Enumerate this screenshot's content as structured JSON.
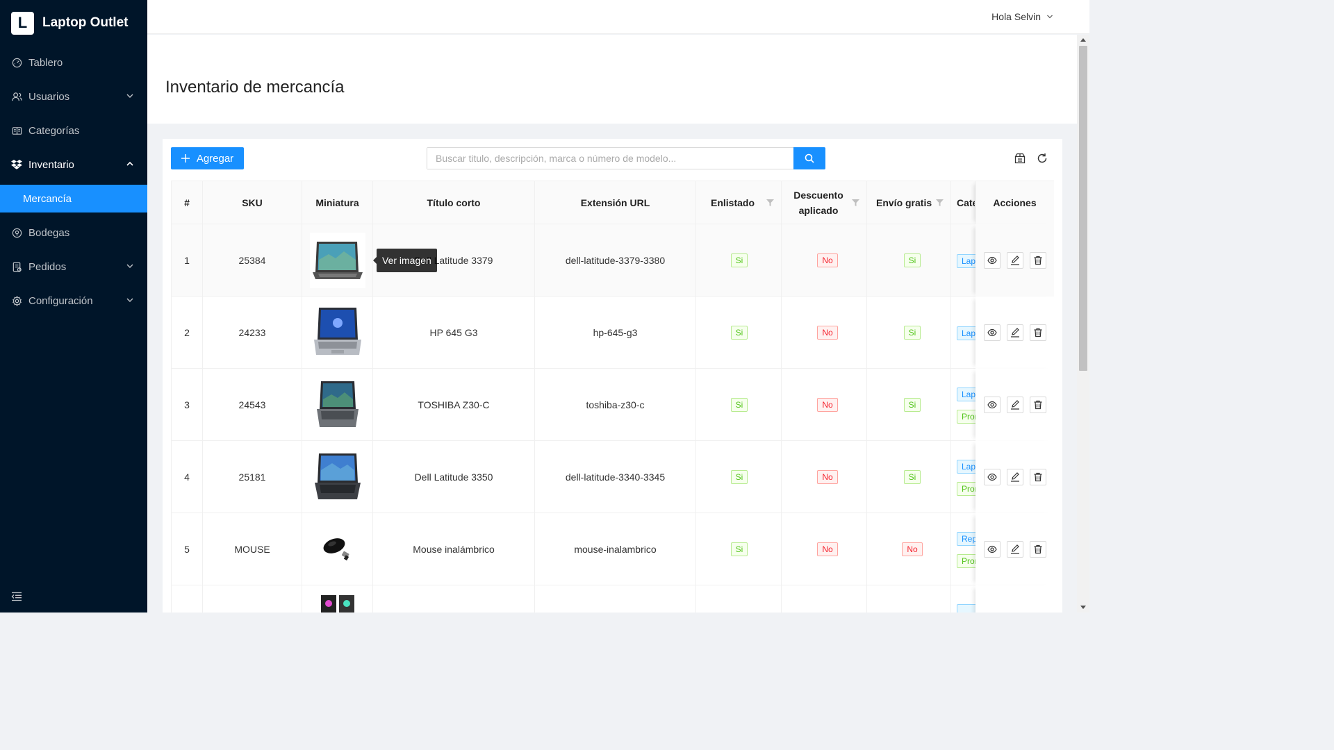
{
  "app": {
    "name": "Laptop Outlet",
    "logo_letter": "L"
  },
  "sidebar": {
    "items": [
      {
        "label": "Tablero",
        "icon": "dashboard-icon"
      },
      {
        "label": "Usuarios",
        "icon": "users-icon"
      },
      {
        "label": "Categorías",
        "icon": "categories-icon"
      },
      {
        "label": "Inventario",
        "icon": "dropbox-icon"
      },
      {
        "label": "Mercancía"
      },
      {
        "label": "Bodegas",
        "icon": "location-icon"
      },
      {
        "label": "Pedidos",
        "icon": "orders-icon"
      },
      {
        "label": "Configuración",
        "icon": "settings-icon"
      }
    ]
  },
  "header": {
    "greeting": "Hola Selvin"
  },
  "page": {
    "title": "Inventario de mercancía"
  },
  "toolbar": {
    "add_label": "Agregar",
    "search_placeholder": "Buscar titulo, descripción, marca o número de modelo..."
  },
  "table": {
    "columns": [
      "#",
      "SKU",
      "Miniatura",
      "Título corto",
      "Extensión URL",
      "Enlistado",
      "Descuento aplicado",
      "Envío gratis",
      "Cate",
      "Acciones"
    ],
    "rows": [
      {
        "n": "1",
        "sku": "25384",
        "title": "Dell Latitude 3379",
        "url": "dell-latitude-3379-3380",
        "listed": "Si",
        "discount": "No",
        "shipping": "Si",
        "cats": [
          "Laptops"
        ]
      },
      {
        "n": "2",
        "sku": "24233",
        "title": "HP 645 G3",
        "url": "hp-645-g3",
        "listed": "Si",
        "discount": "No",
        "shipping": "Si",
        "cats": [
          "Laptops"
        ]
      },
      {
        "n": "3",
        "sku": "24543",
        "title": "TOSHIBA Z30-C",
        "url": "toshiba-z30-c",
        "listed": "Si",
        "discount": "No",
        "shipping": "Si",
        "cats": [
          "Laptops",
          "Promociones"
        ]
      },
      {
        "n": "4",
        "sku": "25181",
        "title": "Dell Latitude 3350",
        "url": "dell-latitude-3340-3345",
        "listed": "Si",
        "discount": "No",
        "shipping": "Si",
        "cats": [
          "Laptops",
          "Promociones"
        ]
      },
      {
        "n": "5",
        "sku": "MOUSE",
        "title": "Mouse inalámbrico",
        "url": "mouse-inalambrico",
        "listed": "Si",
        "discount": "No",
        "shipping": "No",
        "cats": [
          "Repuestos",
          "Promociones"
        ]
      }
    ]
  },
  "tooltip": {
    "text": "Ver imagen"
  },
  "colors": {
    "sidebar": "#001529",
    "primary": "#1890ff",
    "yes": "#52c41a",
    "no": "#f5222d"
  }
}
